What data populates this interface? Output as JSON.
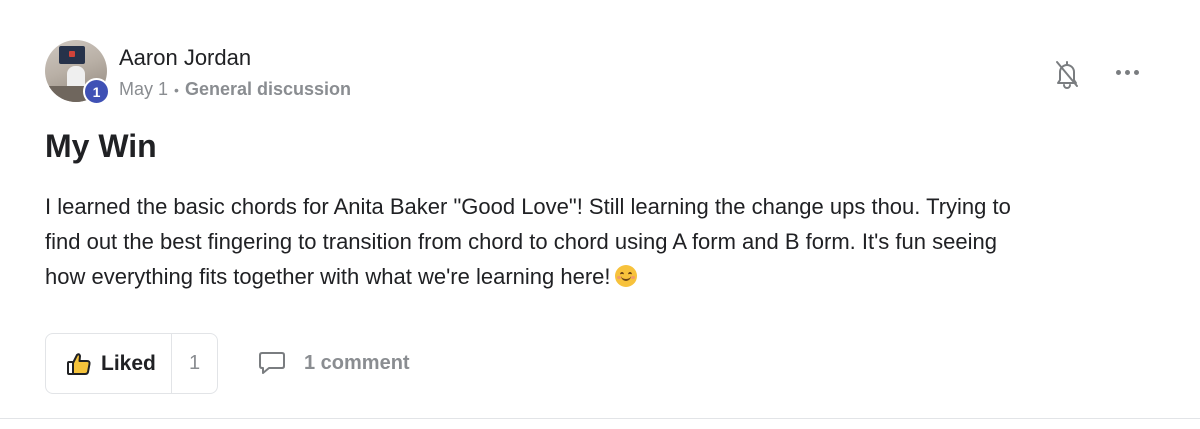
{
  "post": {
    "author": {
      "name": "Aaron Jordan",
      "level": "1"
    },
    "date": "May 1",
    "separator": "•",
    "category": "General discussion",
    "title": "My Win",
    "body_lines": [
      "I learned the basic chords for Anita Baker \"Good Love\"! Still learning the change ups thou. Trying to",
      "find out the best fingering to transition from chord to chord using A form and B form. It's fun seeing",
      "how everything fits together with what we're learning here!"
    ],
    "emoji": "smiling-face-with-smiling-eyes-icon"
  },
  "actions": {
    "like_label": "Liked",
    "like_count": "1",
    "comment_label": "1 comment"
  },
  "icons": {
    "bell": "bell-off-icon",
    "more": "more-horizontal-icon",
    "like": "thumbs-up-icon",
    "comment": "comment-icon"
  },
  "colors": {
    "badge": "#3f51b5",
    "muted_text": "#8a8d91",
    "primary_text": "#202124",
    "border": "#e2e4e7"
  }
}
